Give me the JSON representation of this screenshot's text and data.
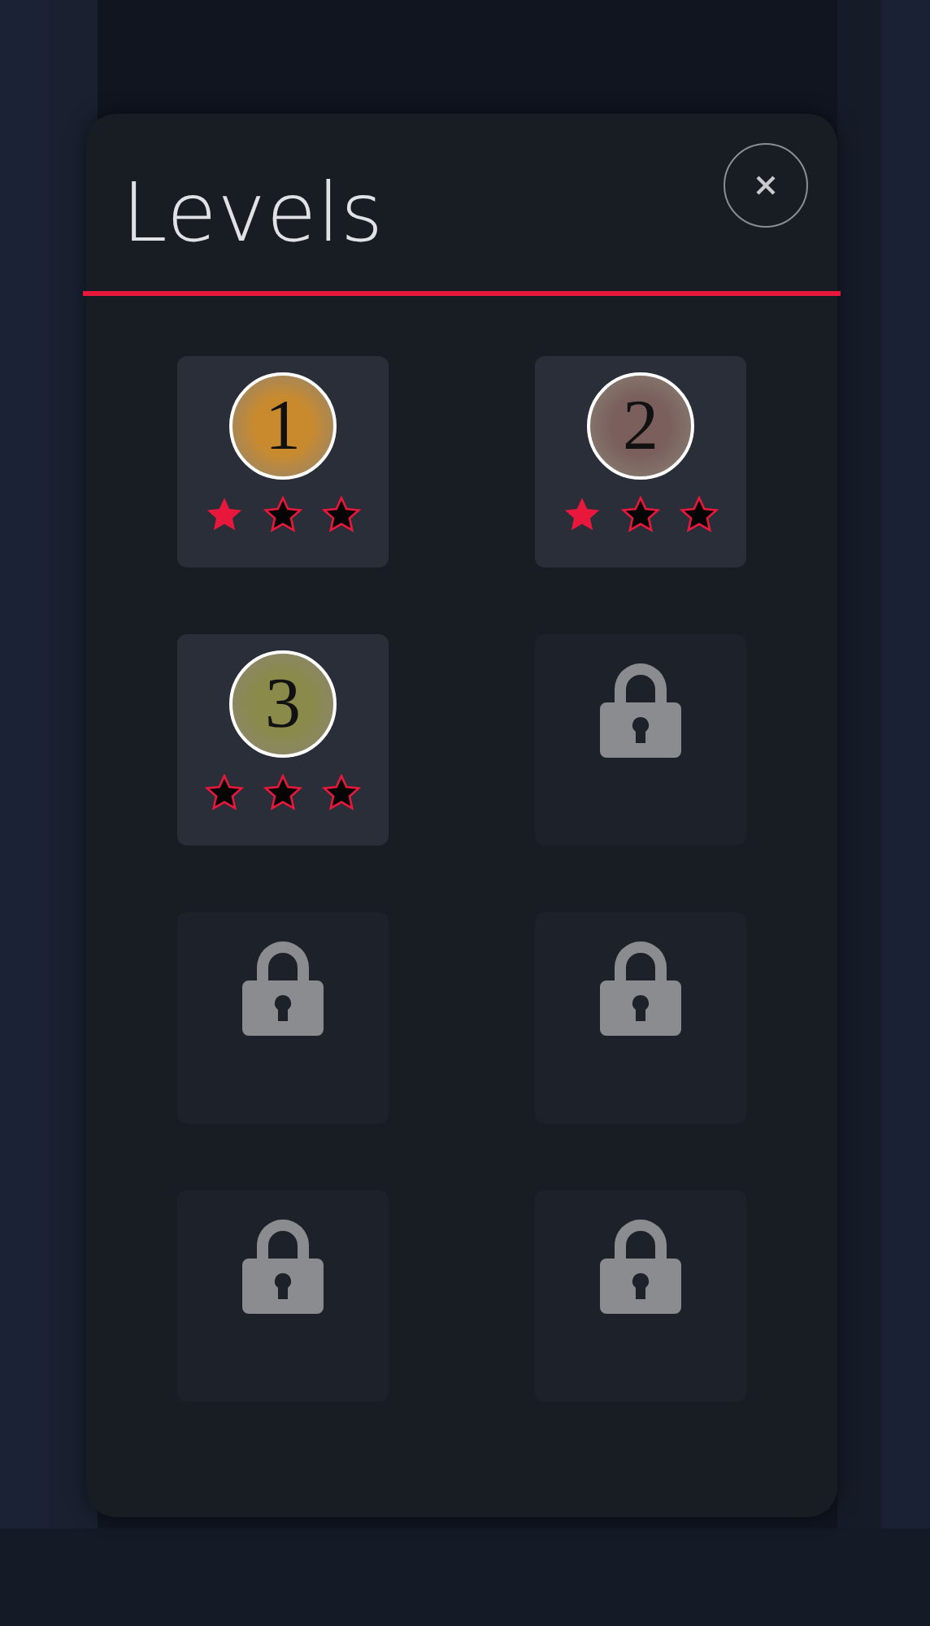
{
  "title": "Levels",
  "levels": [
    {
      "kind": "unlocked",
      "number": "1",
      "color": "#c98a2e",
      "stars": 1
    },
    {
      "kind": "unlocked",
      "number": "2",
      "color": "#7a5f5c",
      "stars": 1
    },
    {
      "kind": "unlocked",
      "number": "3",
      "color": "#8a8a4a",
      "stars": 0
    },
    {
      "kind": "locked"
    },
    {
      "kind": "locked"
    },
    {
      "kind": "locked"
    },
    {
      "kind": "locked"
    },
    {
      "kind": "locked"
    }
  ]
}
